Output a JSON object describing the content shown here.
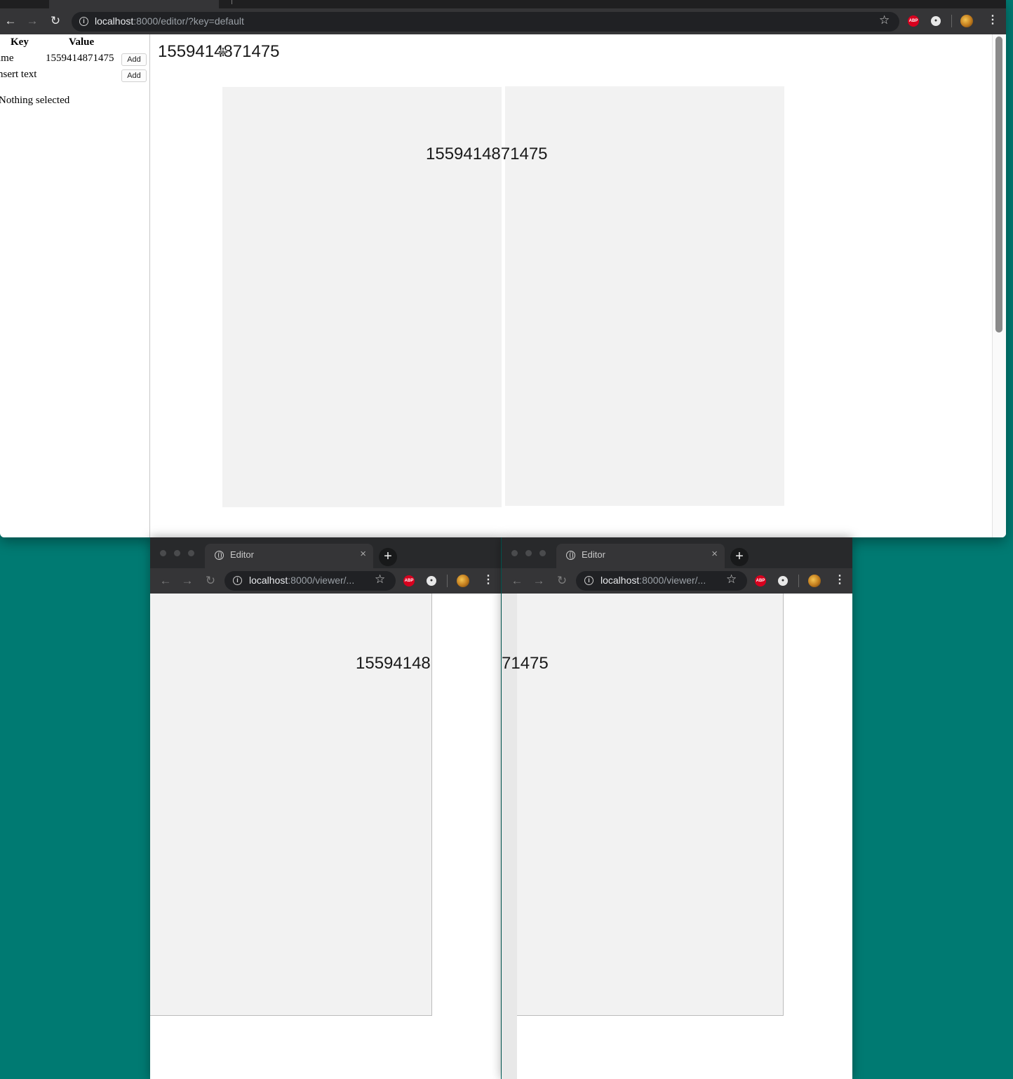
{
  "main_window": {
    "url_host": "localhost",
    "url_rest": ":8000/editor/?key=default",
    "editor_title": "1559414871475",
    "stage_text": "1559414871475"
  },
  "sidebar": {
    "header_key": "Key",
    "header_value": "Value",
    "rows": [
      {
        "key": "ime",
        "value": "1559414871475",
        "button": "Add"
      },
      {
        "key": "nsert text",
        "value": "",
        "button": "Add"
      }
    ],
    "status": "Nothing selected"
  },
  "viewers": [
    {
      "tab_title": "Editor",
      "url_host": "localhost",
      "url_rest": ":8000/viewer/...",
      "visible_text": "15594148"
    },
    {
      "tab_title": "Editor",
      "url_host": "localhost",
      "url_rest": ":8000/viewer/...",
      "visible_text": "71475"
    }
  ],
  "icons": {
    "back": "arrow-left",
    "forward": "arrow-right",
    "reload": "reload",
    "info": "info-circle",
    "bookmark": "star",
    "adblock": "ABP",
    "extension": "circle-extension",
    "profile": "avatar",
    "menu": "kebab",
    "new_tab": "+",
    "tab_close": "×",
    "tab_favicon": "globe"
  },
  "extension_labels": {
    "adblock": "ABP"
  },
  "colors": {
    "desktop": "#007a72",
    "toolbar": "#353537",
    "omnibox": "#202124",
    "page_panel": "#f2f2f2"
  }
}
